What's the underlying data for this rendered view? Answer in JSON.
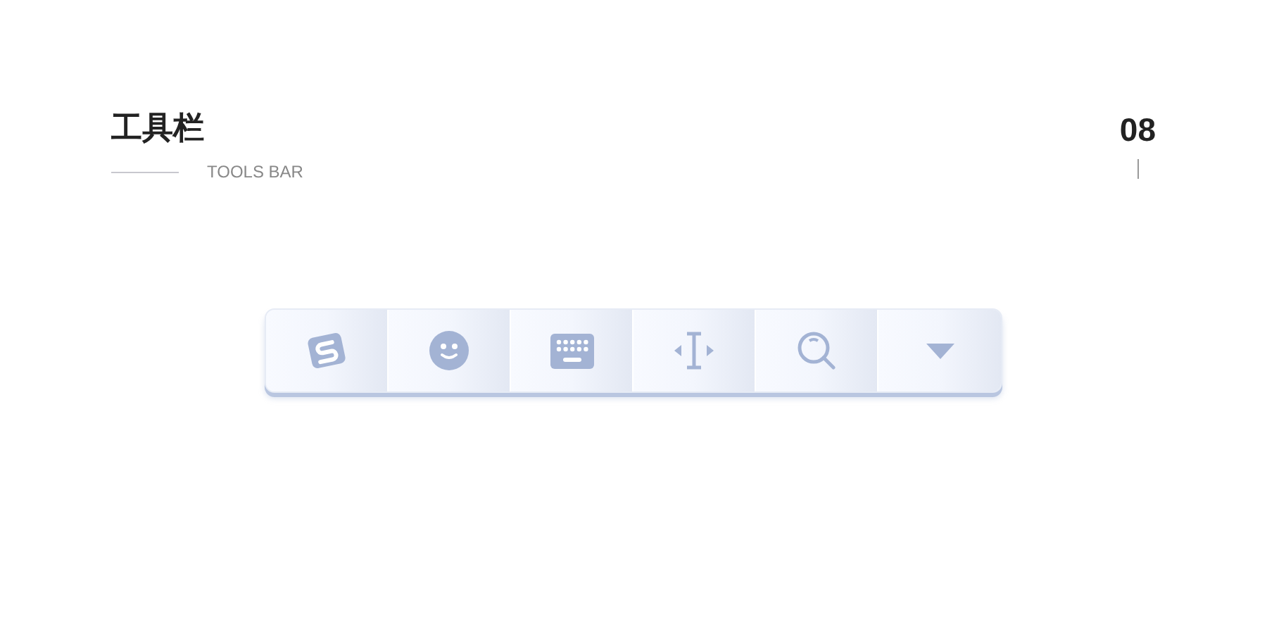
{
  "header": {
    "title": "工具栏",
    "subtitle": "TOOLS BAR",
    "page_number": "08"
  }
}
